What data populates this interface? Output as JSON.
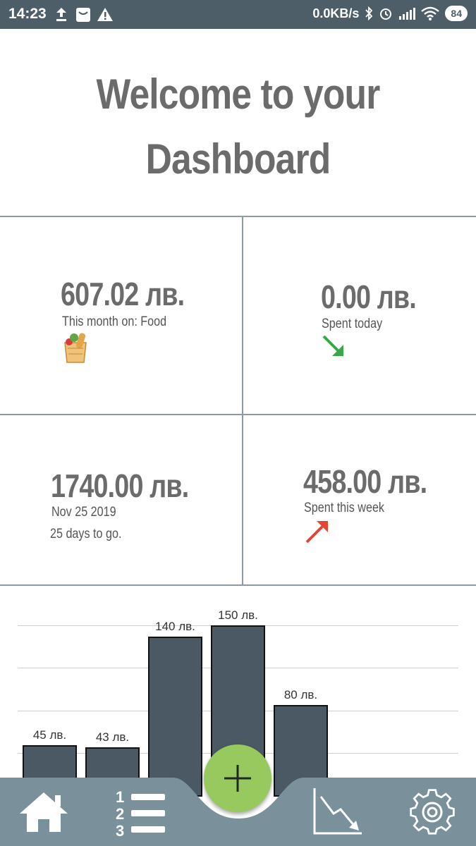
{
  "status_bar": {
    "time": "14:23",
    "network_speed": "0.0KB/s",
    "battery": "84",
    "icons": [
      "upload-icon",
      "mail-icon",
      "warning-icon",
      "bluetooth-icon",
      "alarm-icon",
      "signal-icon",
      "wifi-icon",
      "battery-icon"
    ]
  },
  "header": {
    "line1": "Welcome to your",
    "line2": "Dashboard"
  },
  "cards": {
    "month": {
      "amount": "607.02 лв.",
      "label": "This month on: Food",
      "icon": "grocery-basket-icon"
    },
    "today": {
      "amount": "0.00 лв.",
      "label": "Spent today",
      "icon": "arrow-down-right-icon",
      "icon_color": "#3aa64a"
    },
    "budget": {
      "amount": "1740.00 лв.",
      "date": "Nov 25 2019",
      "days_left": "25 days to go."
    },
    "week": {
      "amount": "458.00 лв.",
      "label": "Spent this week",
      "icon": "arrow-up-right-icon",
      "icon_color": "#e8452f"
    }
  },
  "chart_data": {
    "type": "bar",
    "values": [
      45,
      43,
      140,
      150,
      80
    ],
    "data_labels": [
      "45 лв.",
      "43 лв.",
      "140 лв.",
      "150 лв.",
      "80 лв."
    ],
    "bar_color": "#4a5964"
  },
  "bottom_nav": {
    "items": [
      "home-icon",
      "list-icon",
      "add-icon",
      "statistics-icon",
      "settings-icon"
    ],
    "bar_color": "#7a909b",
    "fab_color": "#97c95f"
  }
}
